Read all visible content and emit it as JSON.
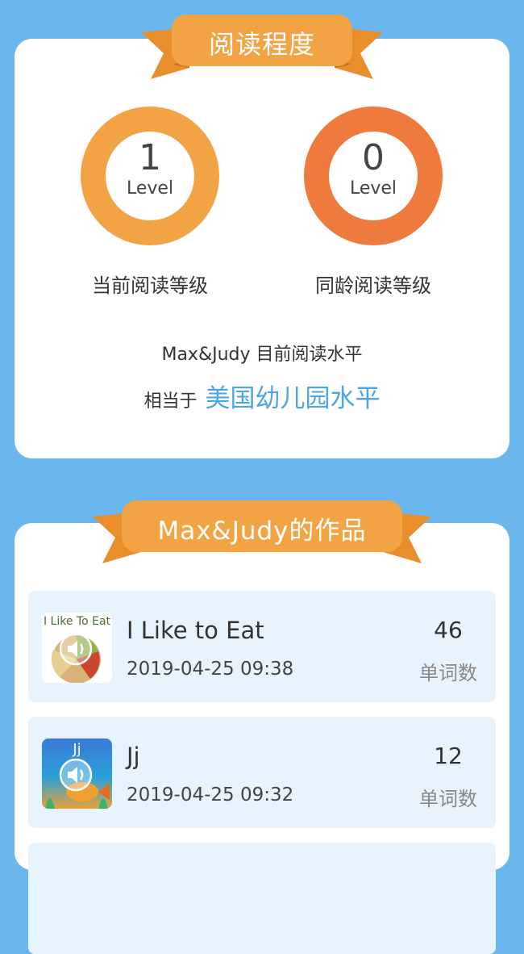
{
  "reading_progress": {
    "title": "阅读程度",
    "current": {
      "value": "1",
      "unit": "Level",
      "caption": "当前阅读等级"
    },
    "peer": {
      "value": "0",
      "unit": "Level",
      "caption": "同龄阅读等级"
    },
    "summary_line": "Max&Judy 目前阅读水平",
    "equivalent_prefix": "相当于",
    "equivalent_level": "美国幼儿园水平"
  },
  "works": {
    "title": "Max&Judy的作品",
    "items": [
      {
        "title": "I Like to Eat",
        "date": "2019-04-25 09:38",
        "count": "46",
        "count_label": "单词数",
        "thumb_text": "I Like To Eat"
      },
      {
        "title": "Jj",
        "date": "2019-04-25 09:32",
        "count": "12",
        "count_label": "单词数",
        "thumb_text": "Jj"
      }
    ]
  },
  "colors": {
    "background": "#6ab6ef",
    "ribbon": "#f2a444",
    "gauge_current": "#f2a444",
    "gauge_peer": "#ef7a3e",
    "highlight": "#4aa6e6",
    "list_item_bg": "#e8f4fd"
  }
}
